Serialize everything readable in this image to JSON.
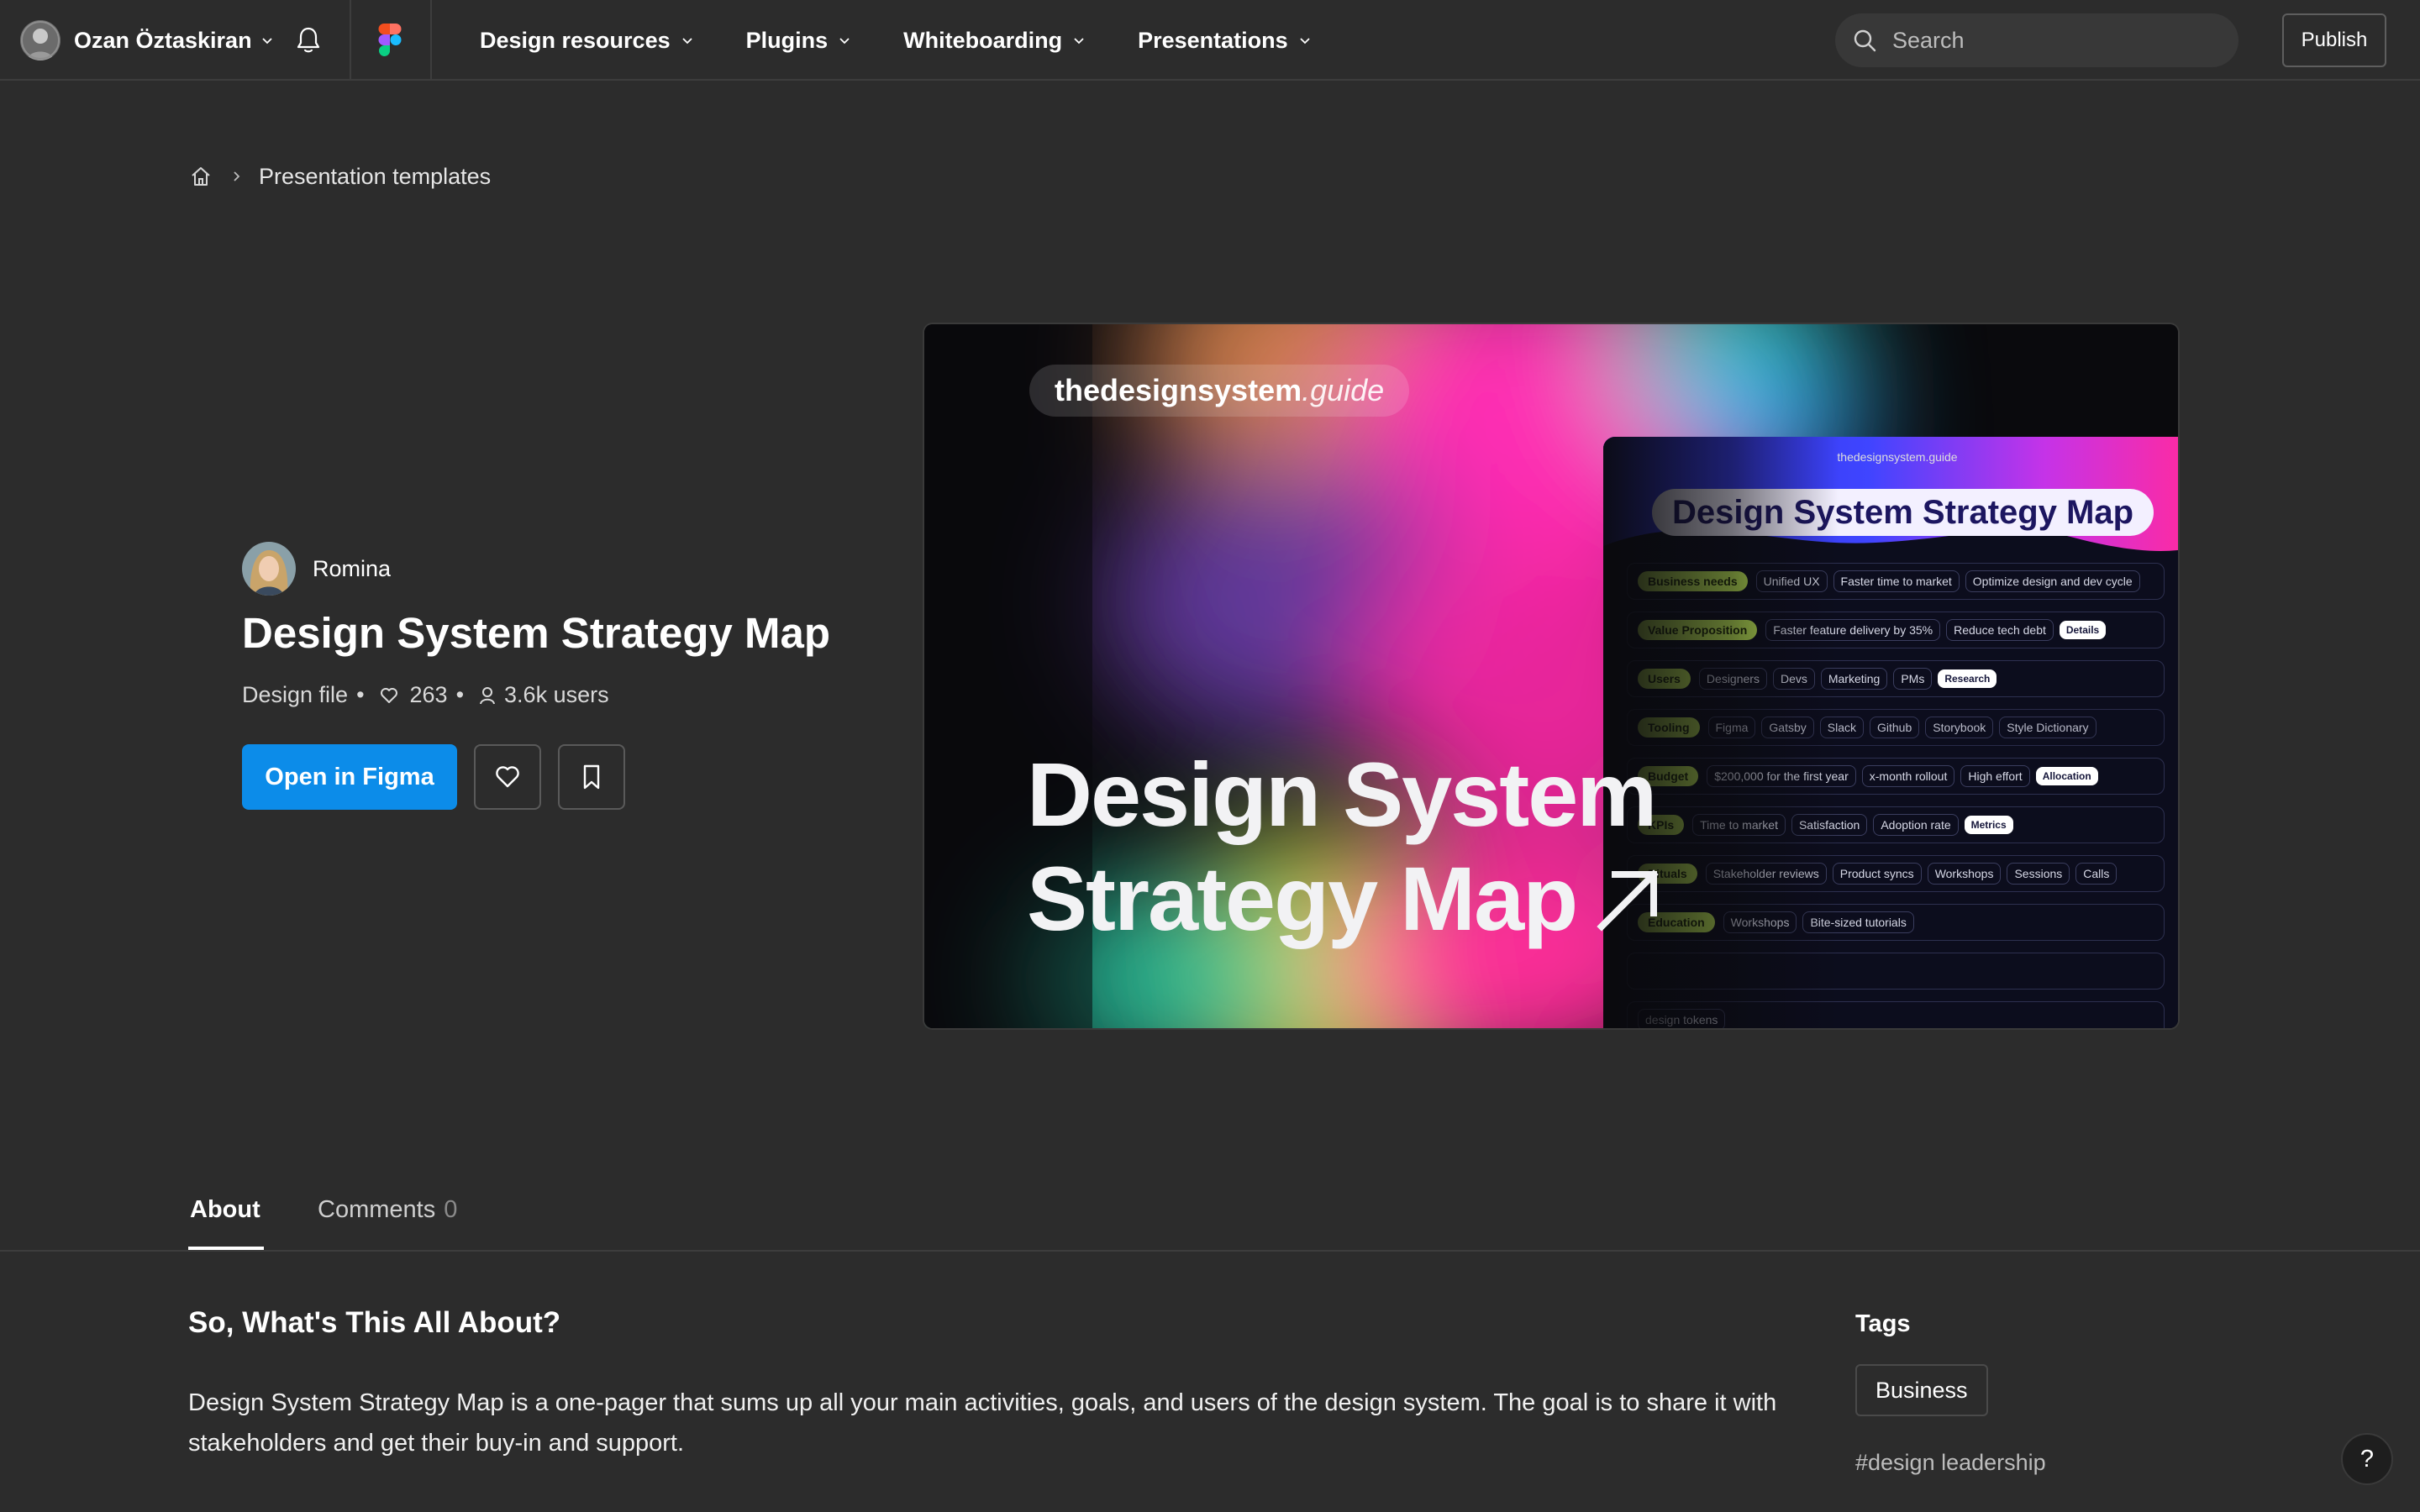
{
  "nav": {
    "user_name": "Ozan Öztaskiran",
    "menu": [
      {
        "label": "Design resources"
      },
      {
        "label": "Plugins"
      },
      {
        "label": "Whiteboarding"
      },
      {
        "label": "Presentations"
      }
    ],
    "search_placeholder": "Search",
    "publish_label": "Publish"
  },
  "breadcrumb": {
    "items": [
      {
        "label": "Presentation templates"
      }
    ]
  },
  "resource": {
    "author": "Romina",
    "title": "Design System Strategy Map",
    "type": "Design file",
    "likes": "263",
    "users": "3.6k users",
    "open_label": "Open in Figma"
  },
  "preview": {
    "brand_bold": "thedesignsystem",
    "brand_italic": ".guide",
    "headline_line1": "Design System",
    "headline_line2": "Strategy Map",
    "card_brand": "thedesignsystem.guide",
    "card_title": "Design System Strategy Map",
    "rows": [
      {
        "label": "Business needs",
        "chips": [
          "Unified UX",
          "Faster time to market",
          "Optimize design and dev cycle"
        ],
        "white_chip": ""
      },
      {
        "label": "Value Proposition",
        "chips": [
          "Faster feature delivery by 35%",
          "Reduce tech debt"
        ],
        "white_chip": "Details"
      },
      {
        "label": "Users",
        "chips": [
          "Designers",
          "Devs",
          "Marketing",
          "PMs"
        ],
        "white_chip": "Research"
      },
      {
        "label": "Tooling",
        "chips": [
          "Figma",
          "Gatsby",
          "Slack",
          "Github",
          "Storybook",
          "Style Dictionary"
        ],
        "white_chip": ""
      },
      {
        "label": "Budget",
        "chips": [
          "$200,000 for the first year",
          "x-month rollout",
          "High effort"
        ],
        "white_chip": "Allocation"
      },
      {
        "label": "KPIs",
        "chips": [
          "Time to market",
          "Satisfaction",
          "Adoption rate"
        ],
        "white_chip": "Metrics"
      },
      {
        "label": "Rituals",
        "chips": [
          "Stakeholder reviews",
          "Product syncs",
          "Workshops",
          "Sessions",
          "Calls"
        ],
        "white_chip": ""
      },
      {
        "label": "Education",
        "chips": [
          "Workshops",
          "Bite-sized tutorials"
        ],
        "white_chip": ""
      },
      {
        "label": "",
        "chips": [],
        "white_chip": ""
      },
      {
        "label": "",
        "chips": [
          "design tokens"
        ],
        "white_chip": ""
      }
    ]
  },
  "tabs": [
    {
      "label": "About"
    },
    {
      "label": "Comments",
      "count": "0"
    }
  ],
  "about": {
    "heading": "So, What's This All About?",
    "description": "Design System Strategy Map is a one-pager that sums up all your main activities, goals, and users of the design system. The goal is to share it with stakeholders and get their buy-in and support."
  },
  "tags": {
    "heading": "Tags",
    "category": "Business",
    "hashtags": [
      "#design leadership"
    ]
  },
  "help_label": "?",
  "colors": {
    "bg": "#2c2c2c",
    "primary": "#0c8ce9",
    "lime": "#c8f55a",
    "card_title": "#1c1660"
  }
}
